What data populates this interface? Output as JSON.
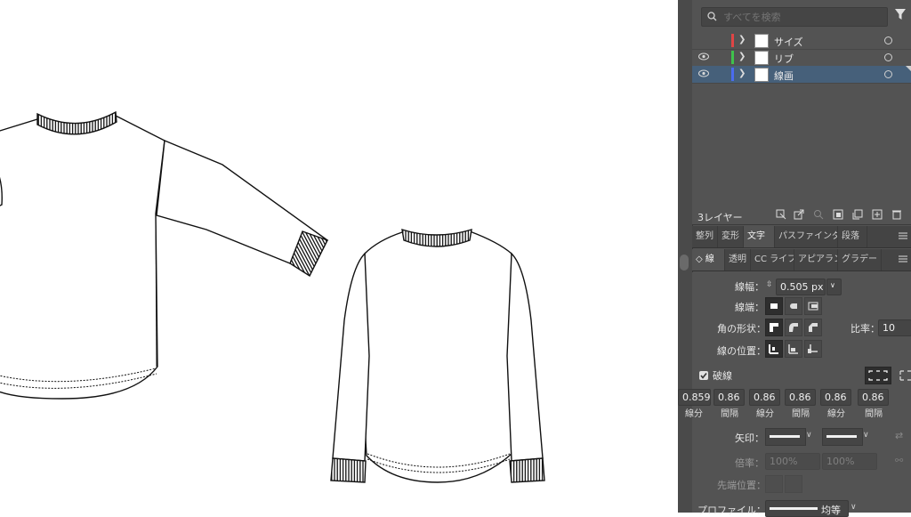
{
  "layers_panel": {
    "search_placeholder": "すべてを検索",
    "layers": [
      {
        "name": "サイズ",
        "color": "#e04545",
        "visible": false,
        "selected": false
      },
      {
        "name": "リブ",
        "color": "#3fc24c",
        "visible": true,
        "selected": false
      },
      {
        "name": "線画",
        "color": "#4a6cf0",
        "visible": true,
        "selected": true
      }
    ],
    "layer_count": "3レイヤー"
  },
  "tabs_top": [
    "整列",
    "変形",
    "文字",
    "パスファインダ",
    "段落"
  ],
  "tabs_top_active": "文字",
  "tabs_stroke": [
    "線",
    "透明",
    "CC ライブ",
    "アピアランス",
    "グラデー"
  ],
  "tabs_stroke_active": "線",
  "stroke": {
    "weight_label": "線幅：",
    "weight_value": "0.505 px",
    "cap_label": "線端：",
    "corner_label": "角の形状：",
    "limit_label": "比率：",
    "limit_value": "10",
    "align_label": "線の位置：",
    "dashed_label": "破線",
    "dash_values": [
      "0.859",
      "0.86",
      "0.86",
      "0.86",
      "0.86",
      "0.86"
    ],
    "dash_labels": [
      "線分",
      "間隔",
      "線分",
      "間隔",
      "線分",
      "間隔"
    ],
    "arrow_label": "矢印：",
    "scale_label": "倍率：",
    "scale_value_1": "100%",
    "scale_value_2": "100%",
    "align_arrow_label": "先端位置：",
    "profile_label": "プロファイル：",
    "profile_value": "均等"
  }
}
